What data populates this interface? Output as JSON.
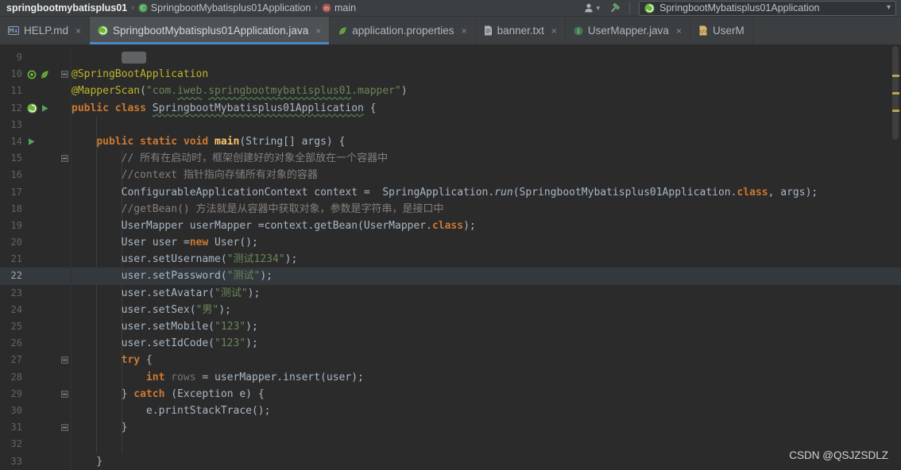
{
  "breadcrumb": {
    "separator": "›",
    "items": [
      {
        "label": "springbootmybatisplus01",
        "icon": null
      },
      {
        "label": "SpringbootMybatisplus01Application",
        "icon": "class-icon"
      },
      {
        "label": "main",
        "icon": "method-icon"
      }
    ]
  },
  "toolbar": {
    "icons": [
      "user-icon",
      "hammer-icon"
    ],
    "run_config": {
      "label": "SpringbootMybatisplus01Application",
      "icon": "spring-boot-icon"
    }
  },
  "tabs": [
    {
      "label": "HELP.md",
      "icon": "markdown-icon",
      "close": "×",
      "active": false
    },
    {
      "label": "SpringbootMybatisplus01Application.java",
      "icon": "spring-boot-icon",
      "close": "×",
      "active": true
    },
    {
      "label": "application.properties",
      "icon": "spring-leaf-icon",
      "close": "×",
      "active": false
    },
    {
      "label": "banner.txt",
      "icon": "text-file-icon",
      "close": "×",
      "active": false
    },
    {
      "label": "UserMapper.java",
      "icon": "interface-icon",
      "close": "×",
      "active": false
    },
    {
      "label": "UserM",
      "icon": "xml-file-icon",
      "close": null,
      "active": false
    }
  ],
  "editor": {
    "current_line": 22,
    "lines": [
      {
        "num": 9,
        "tokens": [
          {
            "t": "        ",
            "c": "def"
          },
          {
            "t": "    ",
            "c": "folded"
          }
        ]
      },
      {
        "num": 10,
        "fold": true,
        "gutter_icons": [
          "spring-bean-icon",
          "spring-leaf-icon"
        ],
        "tokens": [
          {
            "t": "@SpringBootApplication",
            "c": "ann"
          }
        ]
      },
      {
        "num": 11,
        "tokens": [
          {
            "t": "@MapperScan",
            "c": "ann"
          },
          {
            "t": "(",
            "c": "def"
          },
          {
            "t": "\"com.",
            "c": "str"
          },
          {
            "t": "iweb",
            "c": "str typo"
          },
          {
            "t": ".",
            "c": "str"
          },
          {
            "t": "springbootmybatisplus01",
            "c": "str typo"
          },
          {
            "t": ".mapper\"",
            "c": "str"
          },
          {
            "t": ")",
            "c": "def"
          }
        ]
      },
      {
        "num": 12,
        "gutter_icons": [
          "spring-boot-icon",
          "run-icon"
        ],
        "tokens": [
          {
            "t": "public class ",
            "c": "kw"
          },
          {
            "t": "SpringbootMybatisplus01Application",
            "c": "def typo"
          },
          {
            "t": " {",
            "c": "def"
          }
        ]
      },
      {
        "num": 13,
        "tokens": []
      },
      {
        "num": 14,
        "gutter_icons": [
          "run-icon"
        ],
        "tokens": [
          {
            "t": "    ",
            "c": "def"
          },
          {
            "t": "public static void ",
            "c": "kw"
          },
          {
            "t": "main",
            "c": "fn"
          },
          {
            "t": "(String[] args) {",
            "c": "def"
          }
        ]
      },
      {
        "num": 15,
        "fold": true,
        "tokens": [
          {
            "t": "        ",
            "c": "def"
          },
          {
            "t": "// 所有在启动时，框架创建好的对象全部放在一个容器中",
            "c": "com"
          }
        ]
      },
      {
        "num": 16,
        "tokens": [
          {
            "t": "        ",
            "c": "def"
          },
          {
            "t": "//context 指针指向存储所有对象的容器",
            "c": "com"
          }
        ]
      },
      {
        "num": 17,
        "tokens": [
          {
            "t": "        ConfigurableApplicationContext context =  SpringApplication.",
            "c": "def"
          },
          {
            "t": "run",
            "c": "def it"
          },
          {
            "t": "(SpringbootMybatisplus01Application.",
            "c": "def"
          },
          {
            "t": "class",
            "c": "kw"
          },
          {
            "t": ", args);",
            "c": "def"
          }
        ]
      },
      {
        "num": 18,
        "tokens": [
          {
            "t": "        ",
            "c": "def"
          },
          {
            "t": "//getBean() 方法就是从容器中获取对象，参数是字符串，是接口中",
            "c": "com"
          }
        ]
      },
      {
        "num": 19,
        "tokens": [
          {
            "t": "        UserMapper userMapper =context.getBean(UserMapper.",
            "c": "def"
          },
          {
            "t": "class",
            "c": "kw"
          },
          {
            "t": ");",
            "c": "def"
          }
        ]
      },
      {
        "num": 20,
        "tokens": [
          {
            "t": "        User user =",
            "c": "def"
          },
          {
            "t": "new ",
            "c": "kw"
          },
          {
            "t": "User();",
            "c": "def"
          }
        ]
      },
      {
        "num": 21,
        "tokens": [
          {
            "t": "        user.setUsername(",
            "c": "def"
          },
          {
            "t": "\"测试1234\"",
            "c": "str"
          },
          {
            "t": ");",
            "c": "def"
          }
        ]
      },
      {
        "num": 22,
        "current": true,
        "tokens": [
          {
            "t": "        user.setPassword(",
            "c": "def"
          },
          {
            "t": "\"测试\"",
            "c": "str"
          },
          {
            "t": ");",
            "c": "def"
          }
        ]
      },
      {
        "num": 23,
        "tokens": [
          {
            "t": "        user.setAvatar(",
            "c": "def"
          },
          {
            "t": "\"测试\"",
            "c": "str"
          },
          {
            "t": ");",
            "c": "def"
          }
        ]
      },
      {
        "num": 24,
        "tokens": [
          {
            "t": "        user.setSex(",
            "c": "def"
          },
          {
            "t": "\"男\"",
            "c": "str"
          },
          {
            "t": ");",
            "c": "def"
          }
        ]
      },
      {
        "num": 25,
        "tokens": [
          {
            "t": "        user.setMobile(",
            "c": "def"
          },
          {
            "t": "\"123\"",
            "c": "str"
          },
          {
            "t": ");",
            "c": "def"
          }
        ]
      },
      {
        "num": 26,
        "tokens": [
          {
            "t": "        user.setIdCode(",
            "c": "def"
          },
          {
            "t": "\"123\"",
            "c": "str"
          },
          {
            "t": ");",
            "c": "def"
          }
        ]
      },
      {
        "num": 27,
        "fold": true,
        "tokens": [
          {
            "t": "        ",
            "c": "def"
          },
          {
            "t": "try",
            "c": "kw"
          },
          {
            "t": " {",
            "c": "def"
          }
        ]
      },
      {
        "num": 28,
        "tokens": [
          {
            "t": "            ",
            "c": "def"
          },
          {
            "t": "int",
            "c": "kw"
          },
          {
            "t": " ",
            "c": "def"
          },
          {
            "t": "rows",
            "c": "unused"
          },
          {
            "t": " = userMapper.insert(user);",
            "c": "def"
          }
        ]
      },
      {
        "num": 29,
        "fold": true,
        "tokens": [
          {
            "t": "        } ",
            "c": "def"
          },
          {
            "t": "catch",
            "c": "kw"
          },
          {
            "t": " (Exception e) {",
            "c": "def"
          }
        ]
      },
      {
        "num": 30,
        "tokens": [
          {
            "t": "            e.printStackTrace();",
            "c": "def"
          }
        ]
      },
      {
        "num": 31,
        "fold": true,
        "tokens": [
          {
            "t": "        }",
            "c": "def"
          }
        ]
      },
      {
        "num": 32,
        "tokens": []
      },
      {
        "num": 33,
        "tokens": [
          {
            "t": "    }",
            "c": "def"
          }
        ]
      }
    ]
  },
  "watermark": "CSDN @QSJZSDLZ"
}
